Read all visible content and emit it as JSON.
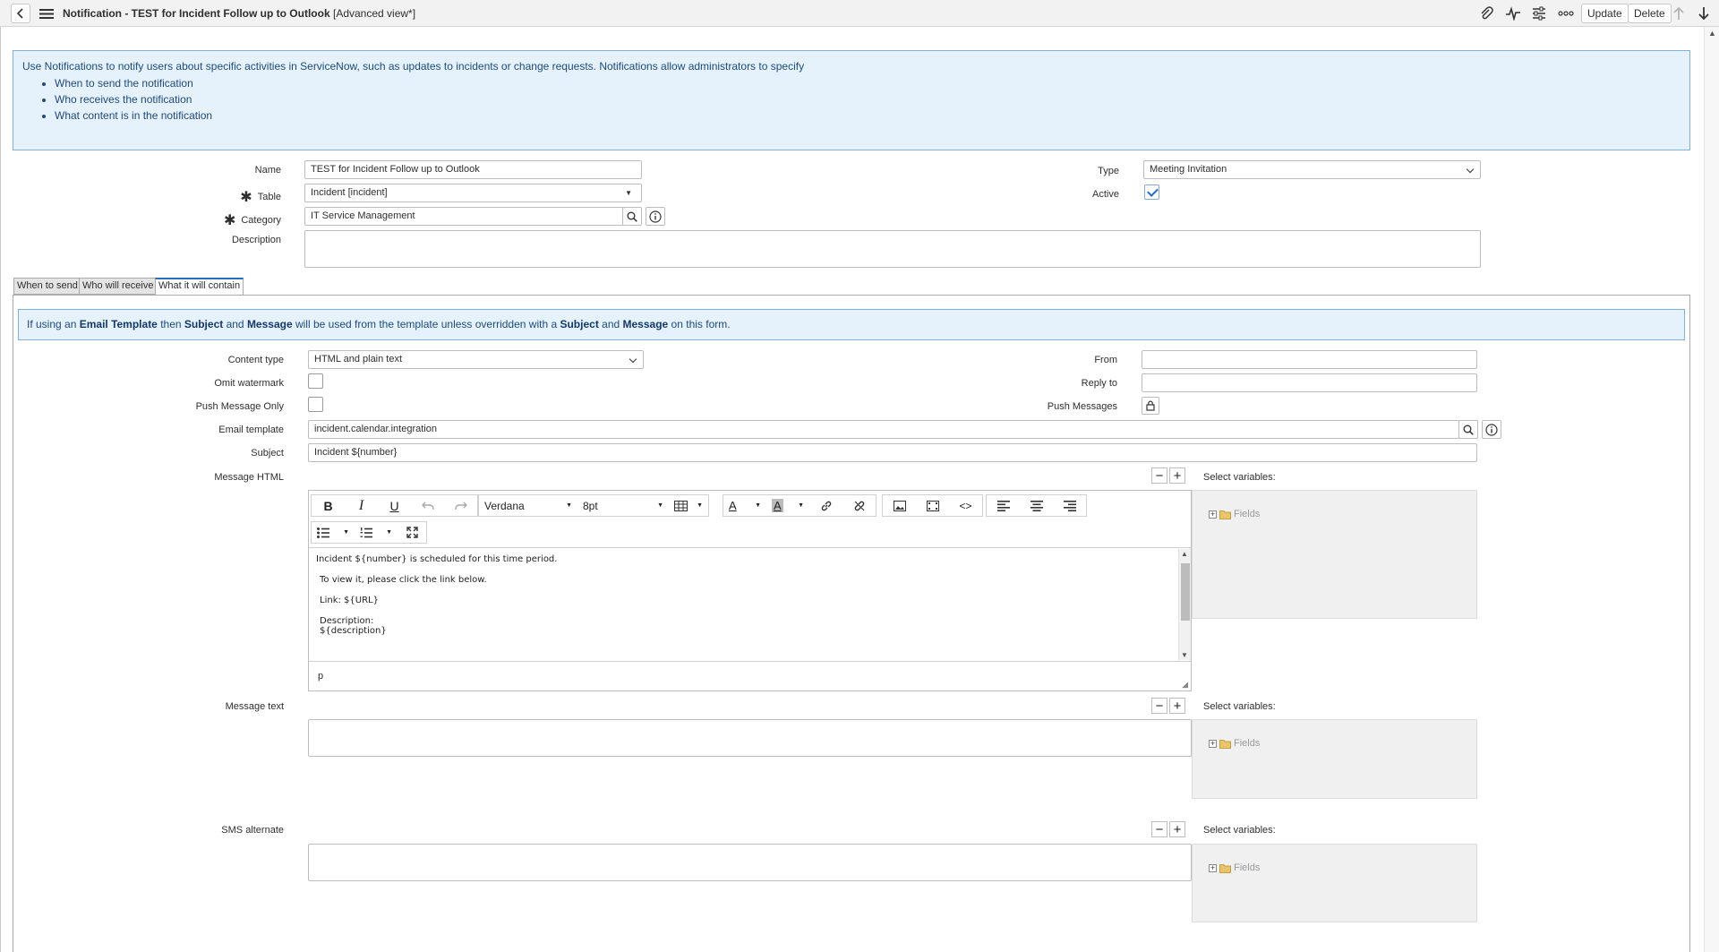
{
  "header": {
    "title": "Notification - TEST for Incident Follow up to Outlook",
    "view": "[Advanced view*]",
    "update_label": "Update",
    "delete_label": "Delete"
  },
  "info": {
    "intro": "Use Notifications to notify users about specific activities in ServiceNow, such as updates to incidents or change requests. Notifications allow administrators to specify",
    "bullets": [
      "When to send the notification",
      "Who receives the notification",
      "What content is in the notification"
    ]
  },
  "form": {
    "name_label": "Name",
    "name_value": "TEST for Incident Follow up to Outlook",
    "table_label": "Table",
    "table_value": "Incident [incident]",
    "category_label": "Category",
    "category_value": "IT Service Management",
    "description_label": "Description",
    "description_value": "",
    "type_label": "Type",
    "type_value": "Meeting Invitation",
    "active_label": "Active",
    "active": true,
    "required_mark": "✱"
  },
  "tabs": [
    {
      "label": "When to send",
      "active": false
    },
    {
      "label": "Who will receive",
      "active": false
    },
    {
      "label": "What it will contain",
      "active": true
    }
  ],
  "notice": {
    "p1": "If using an ",
    "b1": "Email Template",
    "p2": " then ",
    "b2": "Subject",
    "p3": " and ",
    "b3": "Message",
    "p4": " will be used from the template unless overridden with a ",
    "b4": "Subject",
    "p5": " and ",
    "b5": "Message",
    "p6": " on this form."
  },
  "contain": {
    "content_type_label": "Content type",
    "content_type_value": "HTML and plain text",
    "omit_watermark_label": "Omit watermark",
    "omit_watermark": false,
    "push_only_label": "Push Message Only",
    "push_only": false,
    "from_label": "From",
    "from_value": "",
    "reply_to_label": "Reply to",
    "reply_to_value": "",
    "push_messages_label": "Push Messages",
    "email_template_label": "Email template",
    "email_template_value": "incident.calendar.integration",
    "subject_label": "Subject",
    "subject_value": "Incident ${number}",
    "message_html_label": "Message HTML",
    "message_text_label": "Message text",
    "sms_label": "SMS alternate",
    "select_vars_label": "Select variables:",
    "fields_label": "Fields"
  },
  "editor": {
    "font_family": "Verdana",
    "font_size": "8pt",
    "line1": "Incident ${number} is scheduled for this time period.",
    "line2": "To view it, please click the link below.",
    "line3": "Link: ${URL}",
    "line4": "Description:",
    "line5": "${description}",
    "status_path": "p"
  }
}
